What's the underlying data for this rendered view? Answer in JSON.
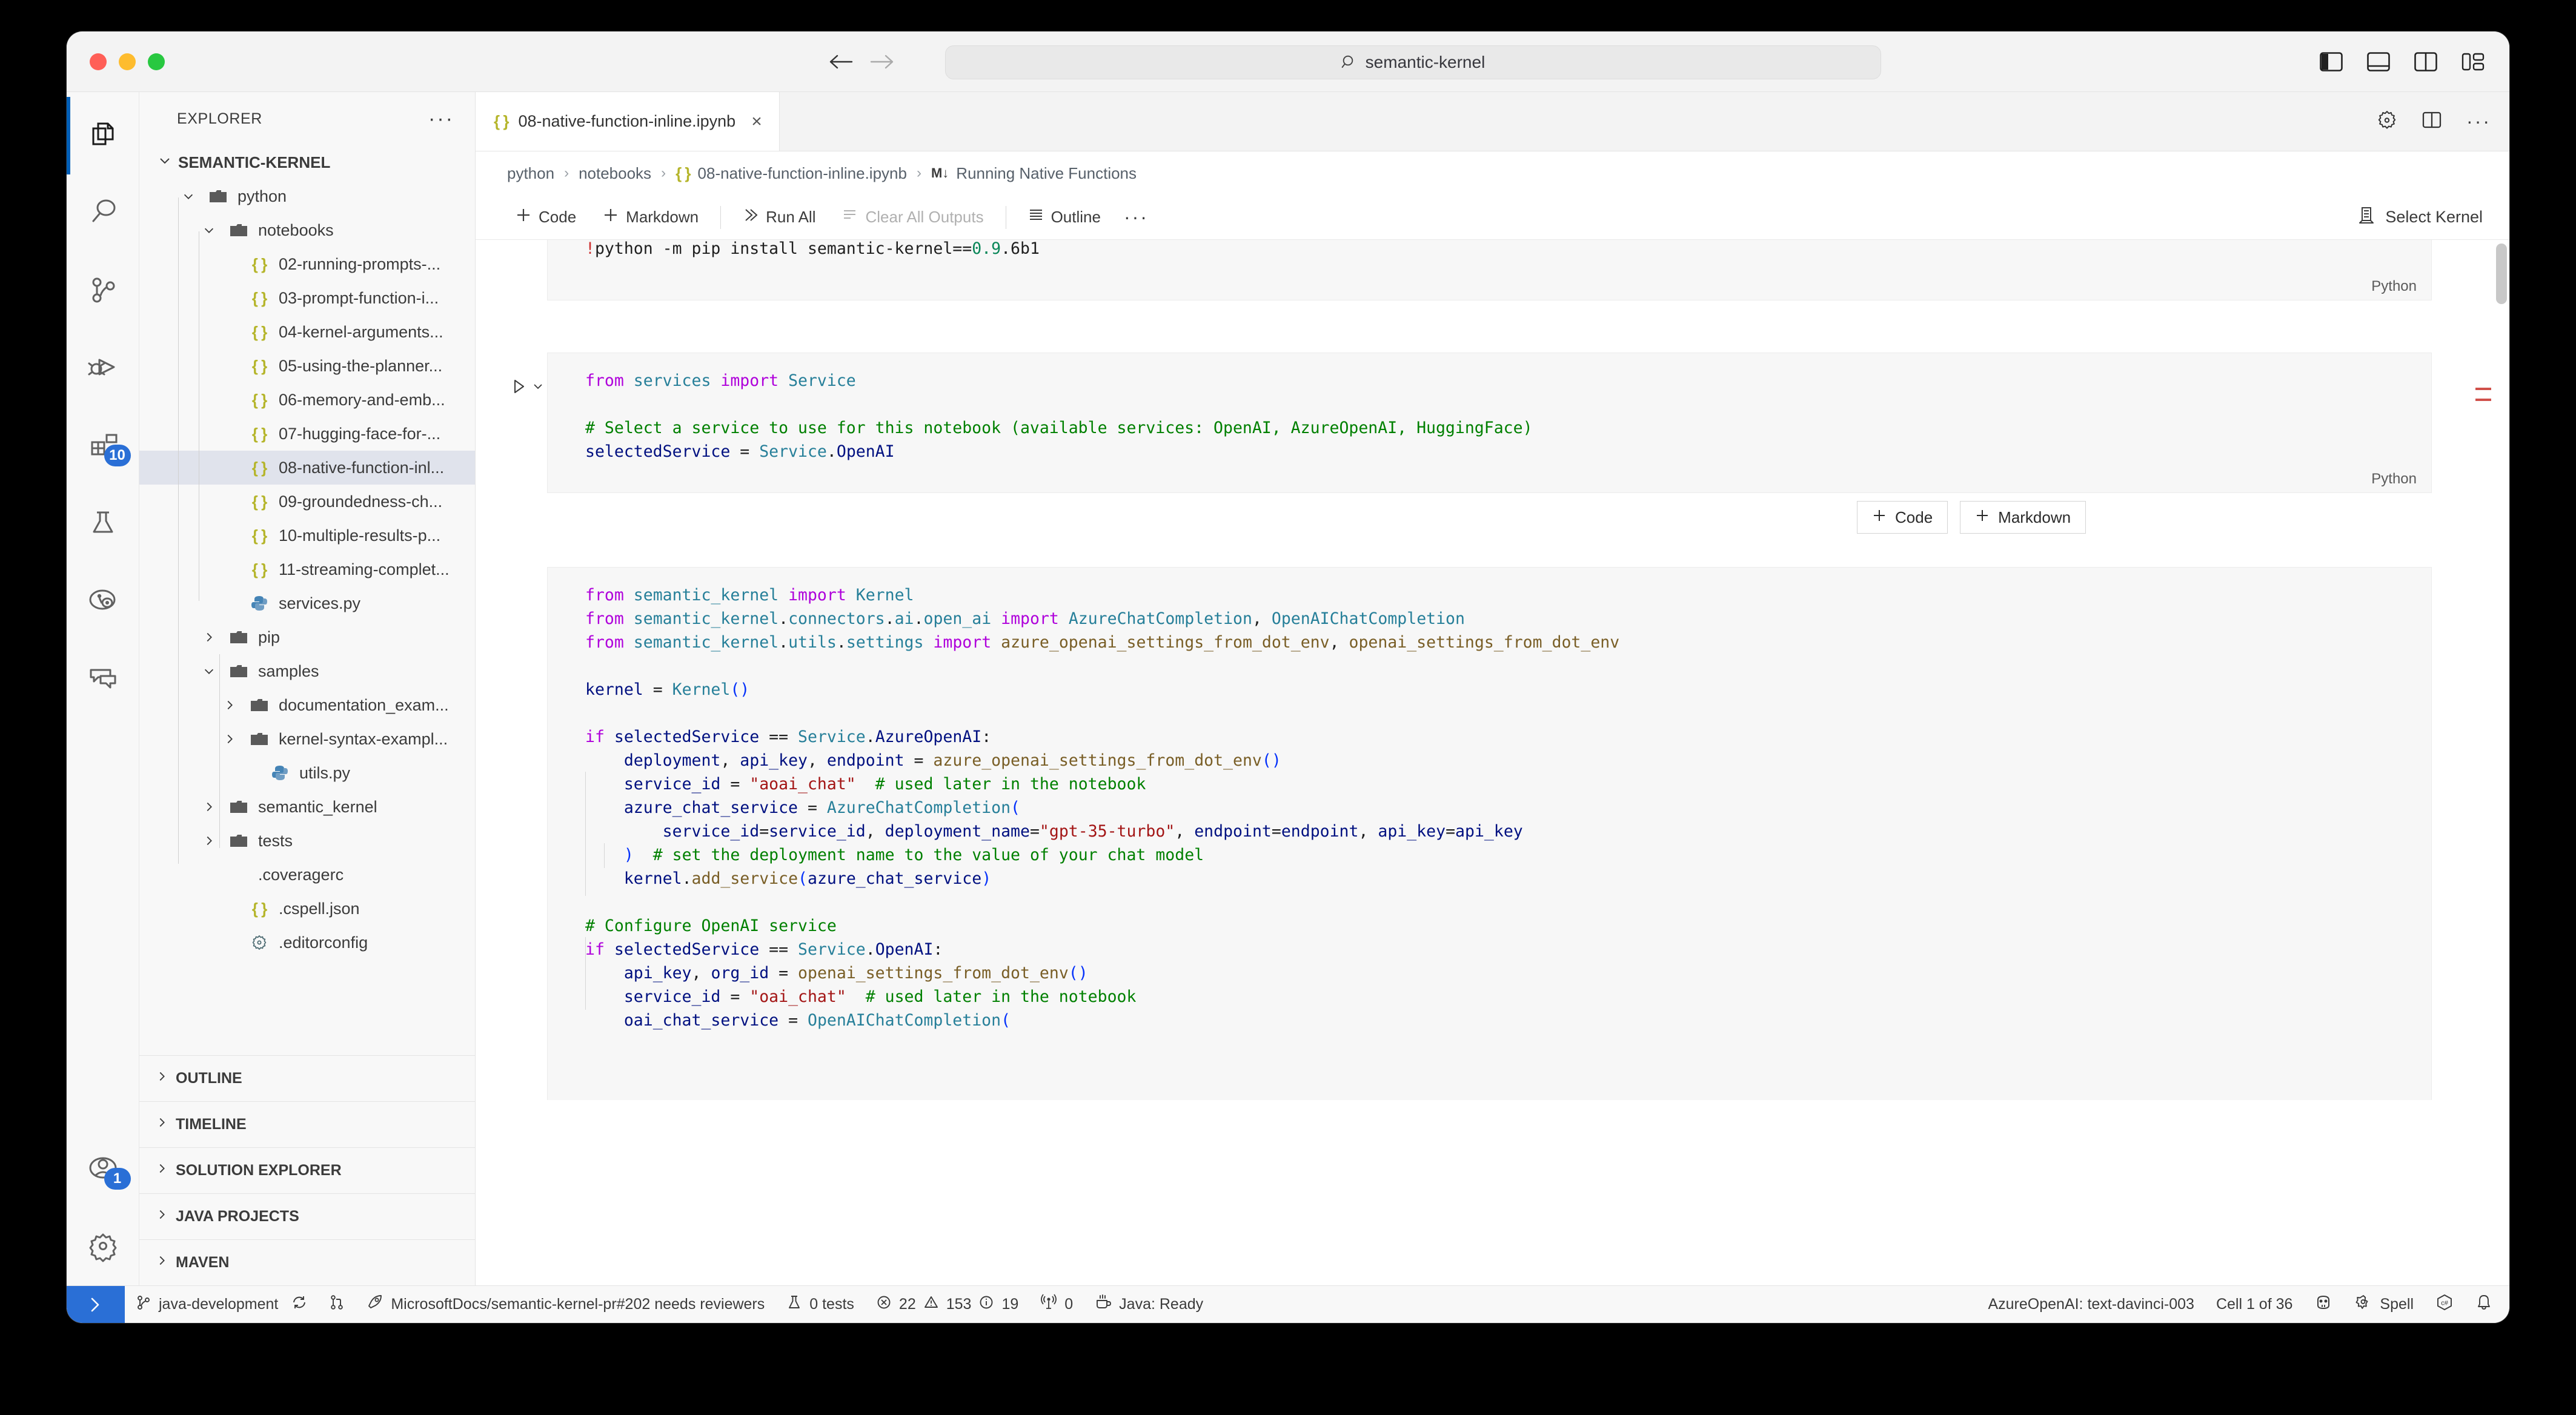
{
  "window": {
    "traffic_lights": [
      "close",
      "minimize",
      "zoom"
    ],
    "search_value": "semantic-kernel",
    "search_placeholder": "Search"
  },
  "activitybar": {
    "items": [
      {
        "name": "explorer",
        "icon": "files-icon",
        "badge": null,
        "active": true
      },
      {
        "name": "search",
        "icon": "search-icon",
        "badge": null,
        "active": false
      },
      {
        "name": "source-control",
        "icon": "source-control-icon",
        "badge": null,
        "active": false
      },
      {
        "name": "run-and-debug",
        "icon": "debug-icon",
        "badge": null,
        "active": false
      },
      {
        "name": "extensions",
        "icon": "extensions-icon",
        "badge": "10",
        "active": false
      },
      {
        "name": "testing",
        "icon": "beaker-icon",
        "badge": null,
        "active": false
      },
      {
        "name": "azure",
        "icon": "azure-icon",
        "badge": null,
        "active": false
      },
      {
        "name": "chat",
        "icon": "comment-discussion-icon",
        "badge": null,
        "active": false
      }
    ],
    "bottom": [
      {
        "name": "accounts",
        "icon": "account-icon",
        "badge": "1"
      },
      {
        "name": "manage",
        "icon": "gear-icon",
        "badge": null
      }
    ]
  },
  "sidebar": {
    "title": "EXPLORER",
    "more_label": "···",
    "root": {
      "label": "SEMANTIC-KERNEL",
      "expanded": true
    },
    "tree": [
      {
        "label": "python",
        "depth": 1,
        "type": "folder",
        "expanded": true
      },
      {
        "label": "notebooks",
        "depth": 2,
        "type": "folder",
        "expanded": true
      },
      {
        "label": "02-running-prompts-...",
        "depth": 3,
        "type": "json"
      },
      {
        "label": "03-prompt-function-i...",
        "depth": 3,
        "type": "json"
      },
      {
        "label": "04-kernel-arguments...",
        "depth": 3,
        "type": "json"
      },
      {
        "label": "05-using-the-planner...",
        "depth": 3,
        "type": "json"
      },
      {
        "label": "06-memory-and-emb...",
        "depth": 3,
        "type": "json"
      },
      {
        "label": "07-hugging-face-for-...",
        "depth": 3,
        "type": "json"
      },
      {
        "label": "08-native-function-inl...",
        "depth": 3,
        "type": "json",
        "selected": true
      },
      {
        "label": "09-groundedness-ch...",
        "depth": 3,
        "type": "json"
      },
      {
        "label": "10-multiple-results-p...",
        "depth": 3,
        "type": "json"
      },
      {
        "label": "11-streaming-complet...",
        "depth": 3,
        "type": "json"
      },
      {
        "label": "services.py",
        "depth": 3,
        "type": "python"
      },
      {
        "label": "pip",
        "depth": 2,
        "type": "folder",
        "expanded": false
      },
      {
        "label": "samples",
        "depth": 2,
        "type": "folder",
        "expanded": true
      },
      {
        "label": "documentation_exam...",
        "depth": 3,
        "type": "folder",
        "expanded": false
      },
      {
        "label": "kernel-syntax-exampl...",
        "depth": 3,
        "type": "folder",
        "expanded": false
      },
      {
        "label": "utils.py",
        "depth": 4,
        "type": "python"
      },
      {
        "label": "semantic_kernel",
        "depth": 2,
        "type": "folder",
        "expanded": false
      },
      {
        "label": "tests",
        "depth": 2,
        "type": "folder",
        "expanded": false
      },
      {
        "label": ".coveragerc",
        "depth": 2,
        "type": "plain"
      },
      {
        "label": ".cspell.json",
        "depth": 3,
        "type": "json"
      },
      {
        "label": ".editorconfig",
        "depth": 3,
        "type": "gear"
      }
    ],
    "sections": [
      "OUTLINE",
      "TIMELINE",
      "SOLUTION EXPLORER",
      "JAVA PROJECTS",
      "MAVEN"
    ]
  },
  "editor": {
    "tab": {
      "label": "08-native-function-inline.ipynb",
      "icon": "json-icon",
      "close": "×"
    },
    "tab_actions": [
      "gear-icon",
      "split-editor-icon",
      "more-icon"
    ],
    "breadcrumb": [
      "python",
      "notebooks",
      "08-native-function-inline.ipynb",
      "Running Native Functions"
    ],
    "breadcrumb_sep": "›",
    "toolbar": {
      "code_label": "Code",
      "markdown_label": "Markdown",
      "run_all_label": "Run All",
      "clear_outputs_label": "Clear All Outputs",
      "outline_label": "Outline",
      "more_label": "···",
      "select_kernel_label": "Select Kernel"
    },
    "inline_add": {
      "code_label": "Code",
      "markdown_label": "Markdown"
    }
  },
  "notebook": {
    "cells": [
      {
        "id": "cell-1",
        "language": "Python",
        "lines": [
          [
            {
              "t": "!",
              "c": "excl"
            },
            {
              "t": "python -m pip install semantic-kernel==",
              "c": "op"
            },
            {
              "t": "0.9",
              "c": "num"
            },
            {
              "t": ".6b1",
              "c": "op"
            }
          ]
        ]
      },
      {
        "id": "cell-2",
        "language": "Python",
        "lines": [
          [
            {
              "t": "from ",
              "c": "k"
            },
            {
              "t": "services ",
              "c": "mod"
            },
            {
              "t": "import ",
              "c": "k"
            },
            {
              "t": "Service",
              "c": "mod"
            }
          ],
          [],
          [
            {
              "t": "# Select a service to use for this notebook (available services: OpenAI, AzureOpenAI, HuggingFace)",
              "c": "cm"
            }
          ],
          [
            {
              "t": "selectedService",
              "c": "var"
            },
            {
              "t": " = ",
              "c": "op"
            },
            {
              "t": "Service",
              "c": "mod"
            },
            {
              "t": ".",
              "c": "op"
            },
            {
              "t": "OpenAI",
              "c": "var"
            }
          ]
        ]
      },
      {
        "id": "cell-3",
        "language": null,
        "lines": [
          [
            {
              "t": "from ",
              "c": "k"
            },
            {
              "t": "semantic_kernel ",
              "c": "mod"
            },
            {
              "t": "import ",
              "c": "k"
            },
            {
              "t": "Kernel",
              "c": "mod"
            }
          ],
          [
            {
              "t": "from ",
              "c": "k"
            },
            {
              "t": "semantic_kernel",
              "c": "mod"
            },
            {
              "t": ".",
              "c": "op"
            },
            {
              "t": "connectors",
              "c": "mod"
            },
            {
              "t": ".",
              "c": "op"
            },
            {
              "t": "ai",
              "c": "mod"
            },
            {
              "t": ".",
              "c": "op"
            },
            {
              "t": "open_ai ",
              "c": "mod"
            },
            {
              "t": "import ",
              "c": "k"
            },
            {
              "t": "AzureChatCompletion",
              "c": "mod"
            },
            {
              "t": ", ",
              "c": "op"
            },
            {
              "t": "OpenAIChatCompletion",
              "c": "mod"
            }
          ],
          [
            {
              "t": "from ",
              "c": "k"
            },
            {
              "t": "semantic_kernel",
              "c": "mod"
            },
            {
              "t": ".",
              "c": "op"
            },
            {
              "t": "utils",
              "c": "mod"
            },
            {
              "t": ".",
              "c": "op"
            },
            {
              "t": "settings ",
              "c": "mod"
            },
            {
              "t": "import ",
              "c": "k"
            },
            {
              "t": "azure_openai_settings_from_dot_env",
              "c": "fn"
            },
            {
              "t": ", ",
              "c": "op"
            },
            {
              "t": "openai_settings_from_dot_env",
              "c": "fn"
            }
          ],
          [],
          [
            {
              "t": "kernel",
              "c": "var"
            },
            {
              "t": " = ",
              "c": "op"
            },
            {
              "t": "Kernel",
              "c": "mod"
            },
            {
              "t": "()",
              "c": "pn"
            }
          ],
          [],
          [
            {
              "t": "if ",
              "c": "k"
            },
            {
              "t": "selectedService",
              "c": "var"
            },
            {
              "t": " == ",
              "c": "op"
            },
            {
              "t": "Service",
              "c": "mod"
            },
            {
              "t": ".",
              "c": "op"
            },
            {
              "t": "AzureOpenAI",
              "c": "var"
            },
            {
              "t": ":",
              "c": "op"
            }
          ],
          [
            {
              "t": "    ",
              "c": "op"
            },
            {
              "t": "deployment",
              "c": "var"
            },
            {
              "t": ", ",
              "c": "op"
            },
            {
              "t": "api_key",
              "c": "var"
            },
            {
              "t": ", ",
              "c": "op"
            },
            {
              "t": "endpoint",
              "c": "var"
            },
            {
              "t": " = ",
              "c": "op"
            },
            {
              "t": "azure_openai_settings_from_dot_env",
              "c": "fn"
            },
            {
              "t": "()",
              "c": "pn"
            }
          ],
          [
            {
              "t": "    ",
              "c": "op"
            },
            {
              "t": "service_id",
              "c": "var"
            },
            {
              "t": " = ",
              "c": "op"
            },
            {
              "t": "\"aoai_chat\"",
              "c": "str"
            },
            {
              "t": "  ",
              "c": "op"
            },
            {
              "t": "# used later in the notebook",
              "c": "cm"
            }
          ],
          [
            {
              "t": "    ",
              "c": "op"
            },
            {
              "t": "azure_chat_service",
              "c": "var"
            },
            {
              "t": " = ",
              "c": "op"
            },
            {
              "t": "AzureChatCompletion",
              "c": "mod"
            },
            {
              "t": "(",
              "c": "pn"
            }
          ],
          [
            {
              "t": "        ",
              "c": "op"
            },
            {
              "t": "service_id",
              "c": "var"
            },
            {
              "t": "=",
              "c": "op"
            },
            {
              "t": "service_id",
              "c": "var"
            },
            {
              "t": ", ",
              "c": "op"
            },
            {
              "t": "deployment_name",
              "c": "var"
            },
            {
              "t": "=",
              "c": "op"
            },
            {
              "t": "\"gpt-35-turbo\"",
              "c": "str"
            },
            {
              "t": ", ",
              "c": "op"
            },
            {
              "t": "endpoint",
              "c": "var"
            },
            {
              "t": "=",
              "c": "op"
            },
            {
              "t": "endpoint",
              "c": "var"
            },
            {
              "t": ", ",
              "c": "op"
            },
            {
              "t": "api_key",
              "c": "var"
            },
            {
              "t": "=",
              "c": "op"
            },
            {
              "t": "api_key",
              "c": "var"
            }
          ],
          [
            {
              "t": "    ",
              "c": "op"
            },
            {
              "t": ")",
              "c": "pn"
            },
            {
              "t": "  ",
              "c": "op"
            },
            {
              "t": "# set the deployment name to the value of your chat model",
              "c": "cm"
            }
          ],
          [
            {
              "t": "    ",
              "c": "op"
            },
            {
              "t": "kernel",
              "c": "var"
            },
            {
              "t": ".",
              "c": "op"
            },
            {
              "t": "add_service",
              "c": "fn"
            },
            {
              "t": "(",
              "c": "pn"
            },
            {
              "t": "azure_chat_service",
              "c": "var"
            },
            {
              "t": ")",
              "c": "pn"
            }
          ],
          [],
          [
            {
              "t": "# Configure OpenAI service",
              "c": "cm"
            }
          ],
          [
            {
              "t": "if ",
              "c": "k"
            },
            {
              "t": "selectedService",
              "c": "var"
            },
            {
              "t": " == ",
              "c": "op"
            },
            {
              "t": "Service",
              "c": "mod"
            },
            {
              "t": ".",
              "c": "op"
            },
            {
              "t": "OpenAI",
              "c": "var"
            },
            {
              "t": ":",
              "c": "op"
            }
          ],
          [
            {
              "t": "    ",
              "c": "op"
            },
            {
              "t": "api_key",
              "c": "var"
            },
            {
              "t": ", ",
              "c": "op"
            },
            {
              "t": "org_id",
              "c": "var"
            },
            {
              "t": " = ",
              "c": "op"
            },
            {
              "t": "openai_settings_from_dot_env",
              "c": "fn"
            },
            {
              "t": "()",
              "c": "pn"
            }
          ],
          [
            {
              "t": "    ",
              "c": "op"
            },
            {
              "t": "service_id",
              "c": "var"
            },
            {
              "t": " = ",
              "c": "op"
            },
            {
              "t": "\"oai_chat\"",
              "c": "str"
            },
            {
              "t": "  ",
              "c": "op"
            },
            {
              "t": "# used later in the notebook",
              "c": "cm"
            }
          ],
          [
            {
              "t": "    ",
              "c": "op"
            },
            {
              "t": "oai_chat_service",
              "c": "var"
            },
            {
              "t": " = ",
              "c": "op"
            },
            {
              "t": "OpenAIChatCompletion",
              "c": "mod"
            },
            {
              "t": "(",
              "c": "pn"
            }
          ]
        ]
      }
    ]
  },
  "statusbar": {
    "remote_icon": "remote-indicator-icon",
    "left": [
      {
        "icon": "source-control-icon",
        "label": "java-development"
      },
      {
        "icon": "sync-icon",
        "label": ""
      },
      {
        "icon": "pull-request-icon",
        "label": ""
      },
      {
        "icon": "rocket-icon",
        "label": "MicrosoftDocs/semantic-kernel-pr#202 needs reviewers"
      },
      {
        "icon": "beaker-icon",
        "label": "0 tests"
      },
      {
        "icon": "error-icon",
        "label": "22"
      },
      {
        "icon": "warning-icon",
        "label": "153"
      },
      {
        "icon": "info-icon",
        "label": "19"
      },
      {
        "icon": "radio-tower-icon",
        "label": "0"
      },
      {
        "icon": "coffee-icon",
        "label": "Java: Ready"
      }
    ],
    "right": [
      {
        "icon": null,
        "label": "AzureOpenAI: text-davinci-003"
      },
      {
        "icon": null,
        "label": "Cell 1 of 36"
      },
      {
        "icon": "robot-icon",
        "label": ""
      },
      {
        "icon": "spell-icon",
        "label": "Spell"
      },
      {
        "icon": "csharp-icon",
        "label": ""
      },
      {
        "icon": "bell-icon",
        "label": ""
      }
    ]
  },
  "colors": {
    "accent": "#005fb8",
    "badge": "#2a6fd6",
    "selection": "#e0e3ec",
    "cell_bg": "#f7f7f7"
  }
}
